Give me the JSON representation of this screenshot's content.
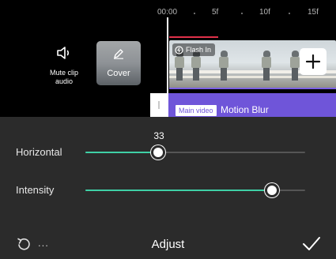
{
  "ruler": {
    "labels": [
      "00:00",
      "5f",
      "10f",
      "15f"
    ]
  },
  "mute": {
    "label_line1": "Mute clip",
    "label_line2": "audio",
    "icon": "speaker-icon"
  },
  "cover": {
    "label": "Cover",
    "icon": "pencil-icon"
  },
  "clip": {
    "badge": "Flash In",
    "badge_icon": "flash-clock-icon",
    "add_icon": "plus-icon"
  },
  "effect": {
    "tag": "Main video",
    "name": "Motion Blur"
  },
  "adjust": {
    "value_label": "33",
    "sliders": [
      {
        "label": "Horizontal",
        "value_percent": 33
      },
      {
        "label": "Intensity",
        "value_percent": 85
      }
    ]
  },
  "bottom": {
    "reset_icon": "reset-icon",
    "more": "...",
    "title": "Adjust",
    "confirm_icon": "checkmark-icon"
  },
  "colors": {
    "accent": "#3fd0a6",
    "effect_bar": "#6f55d9",
    "playhead_marker": "#e0314a",
    "panel_bg": "#2b2b2b"
  }
}
